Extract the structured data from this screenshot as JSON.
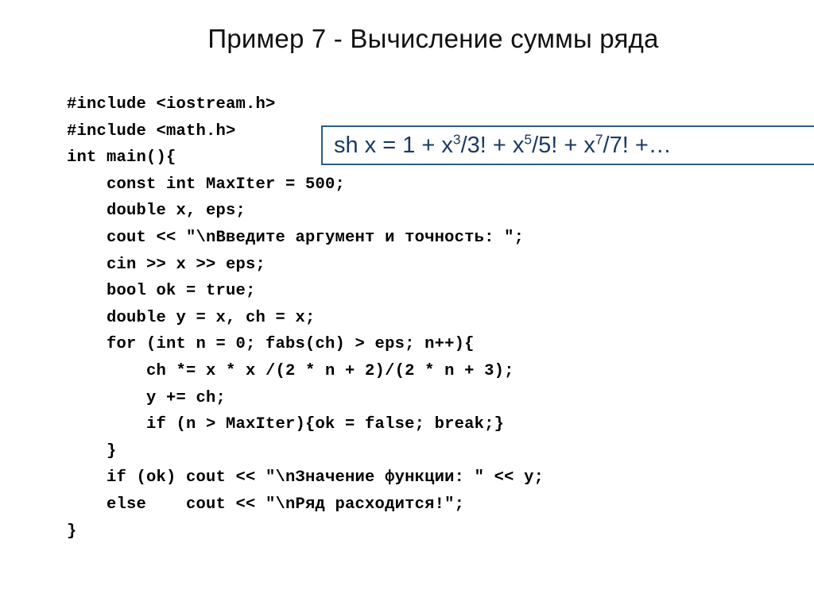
{
  "slide": {
    "title": "Пример 7 - Вычисление суммы ряда",
    "background_color": "#ffffff",
    "text_color": "#000000"
  },
  "formula_callout": {
    "border_color": "#2E5B8C",
    "text_color": "#1B3A63",
    "prefix": "sh x = 1 + x",
    "exp1": "3",
    "mid1": "/3! + x",
    "exp2": "5",
    "mid2": "/5! + x",
    "exp3": "7",
    "suffix": "/7! +…",
    "plain_text": "sh x = 1 + x3/3! + x5/5! + x7/7! +…"
  },
  "code": {
    "language": "cpp",
    "lines": [
      "#include <iostream.h>",
      "#include <math.h>",
      "int main(){",
      "    const int MaxIter = 500;",
      "    double x, eps;",
      "    cout << \"\\nВведите аргумент и точность: \";",
      "    cin >> x >> eps;",
      "    bool ok = true;",
      "    double y = x, ch = x;",
      "    for (int n = 0; fabs(ch) > eps; n++){",
      "        ch *= x * x /(2 * n + 2)/(2 * n + 3);",
      "        y += ch;",
      "        if (n > MaxIter){ok = false; break;}",
      "    }",
      "    if (ok) cout << \"\\nЗначение функции: \" << y;",
      "    else    cout << \"\\nРяд расходится!\";",
      "}"
    ]
  }
}
